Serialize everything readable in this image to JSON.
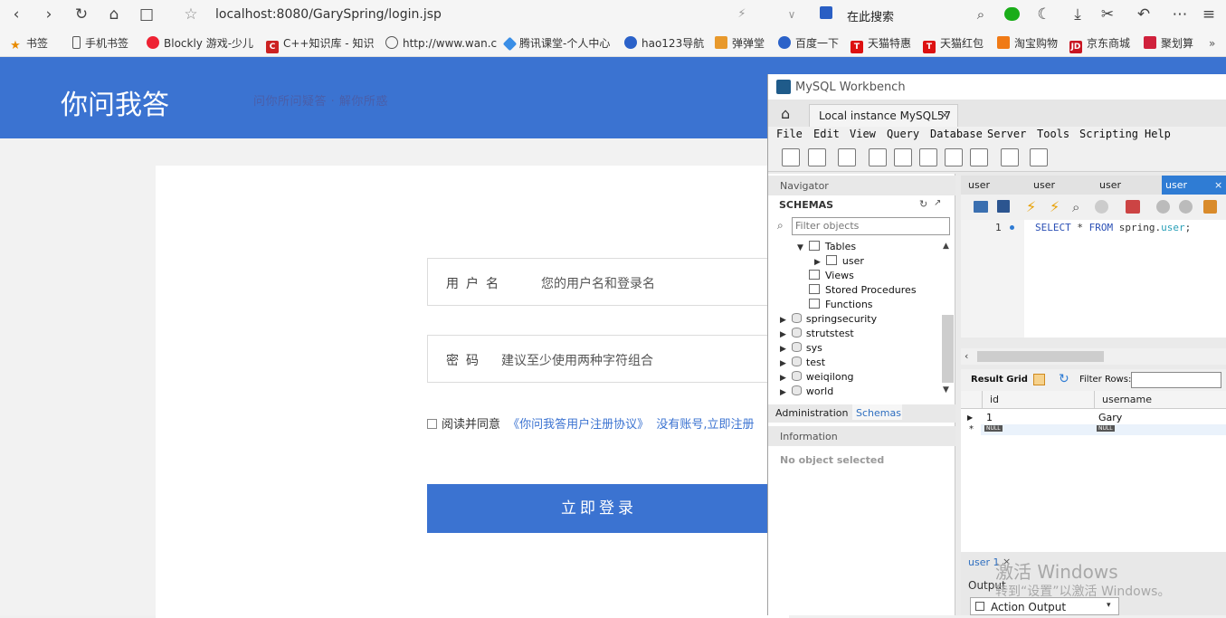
{
  "browser": {
    "url": "localhost:8080/GarySpring/login.jsp",
    "search_placeholder": "在此搜索",
    "bookmarks": [
      "书签",
      "手机书签",
      "Blockly 游戏-少儿",
      "C++知识库 - 知识",
      "http://www.wan.c",
      "腾讯课堂-个人中心",
      "hao123导航",
      "弹弹堂",
      "百度一下",
      "天猫特惠",
      "天猫红包",
      "淘宝购物",
      "京东商城",
      "聚划算"
    ]
  },
  "page": {
    "site_title": "你问我答",
    "site_slogan": "问你所问疑答 · 解你所惑",
    "username_label": "用户名",
    "username_placeholder": "您的用户名和登录名",
    "password_label": "密码",
    "password_placeholder": "建议至少使用两种字符组合",
    "agree_text": "阅读并同意",
    "agreement_link": "《你问我答用户注册协议》",
    "register_link": "没有账号,立即注册",
    "login_button": "立即登录"
  },
  "workbench": {
    "title": "MySQL Workbench",
    "tab": "Local instance MySQL57",
    "menu": [
      "File",
      "Edit",
      "View",
      "Query",
      "Database",
      "Server",
      "Tools",
      "Scripting",
      "Help"
    ],
    "navigator_label": "Navigator",
    "schemas_label": "SCHEMAS",
    "filter_placeholder": "Filter objects",
    "tree": {
      "tables": "Tables",
      "user_table": "user",
      "views": "Views",
      "stored_procedures": "Stored Procedures",
      "functions": "Functions",
      "schemas": [
        "springsecurity",
        "strutstest",
        "sys",
        "test",
        "weiqilong",
        "world"
      ]
    },
    "nav_tabs": [
      "Administration",
      "Schemas"
    ],
    "information_label": "Information",
    "no_object": "No object selected",
    "editor_tabs": [
      "user",
      "user",
      "user",
      "user"
    ],
    "line_number": "1",
    "sql": {
      "select": "SELECT",
      "star": " * ",
      "from": "FROM",
      "schema": " spring.",
      "table": "user",
      "end": ";"
    },
    "result_grid_label": "Result Grid",
    "filter_rows_label": "Filter Rows:",
    "columns": [
      "id",
      "username"
    ],
    "rows": [
      {
        "id": "1",
        "username": "Gary"
      }
    ],
    "null_label": "NULL",
    "result_tab": "user 1",
    "output_label": "Output",
    "action_output": "Action Output"
  },
  "watermark": {
    "title": "激活 Windows",
    "sub": "转到“设置”以激活 Windows。"
  }
}
